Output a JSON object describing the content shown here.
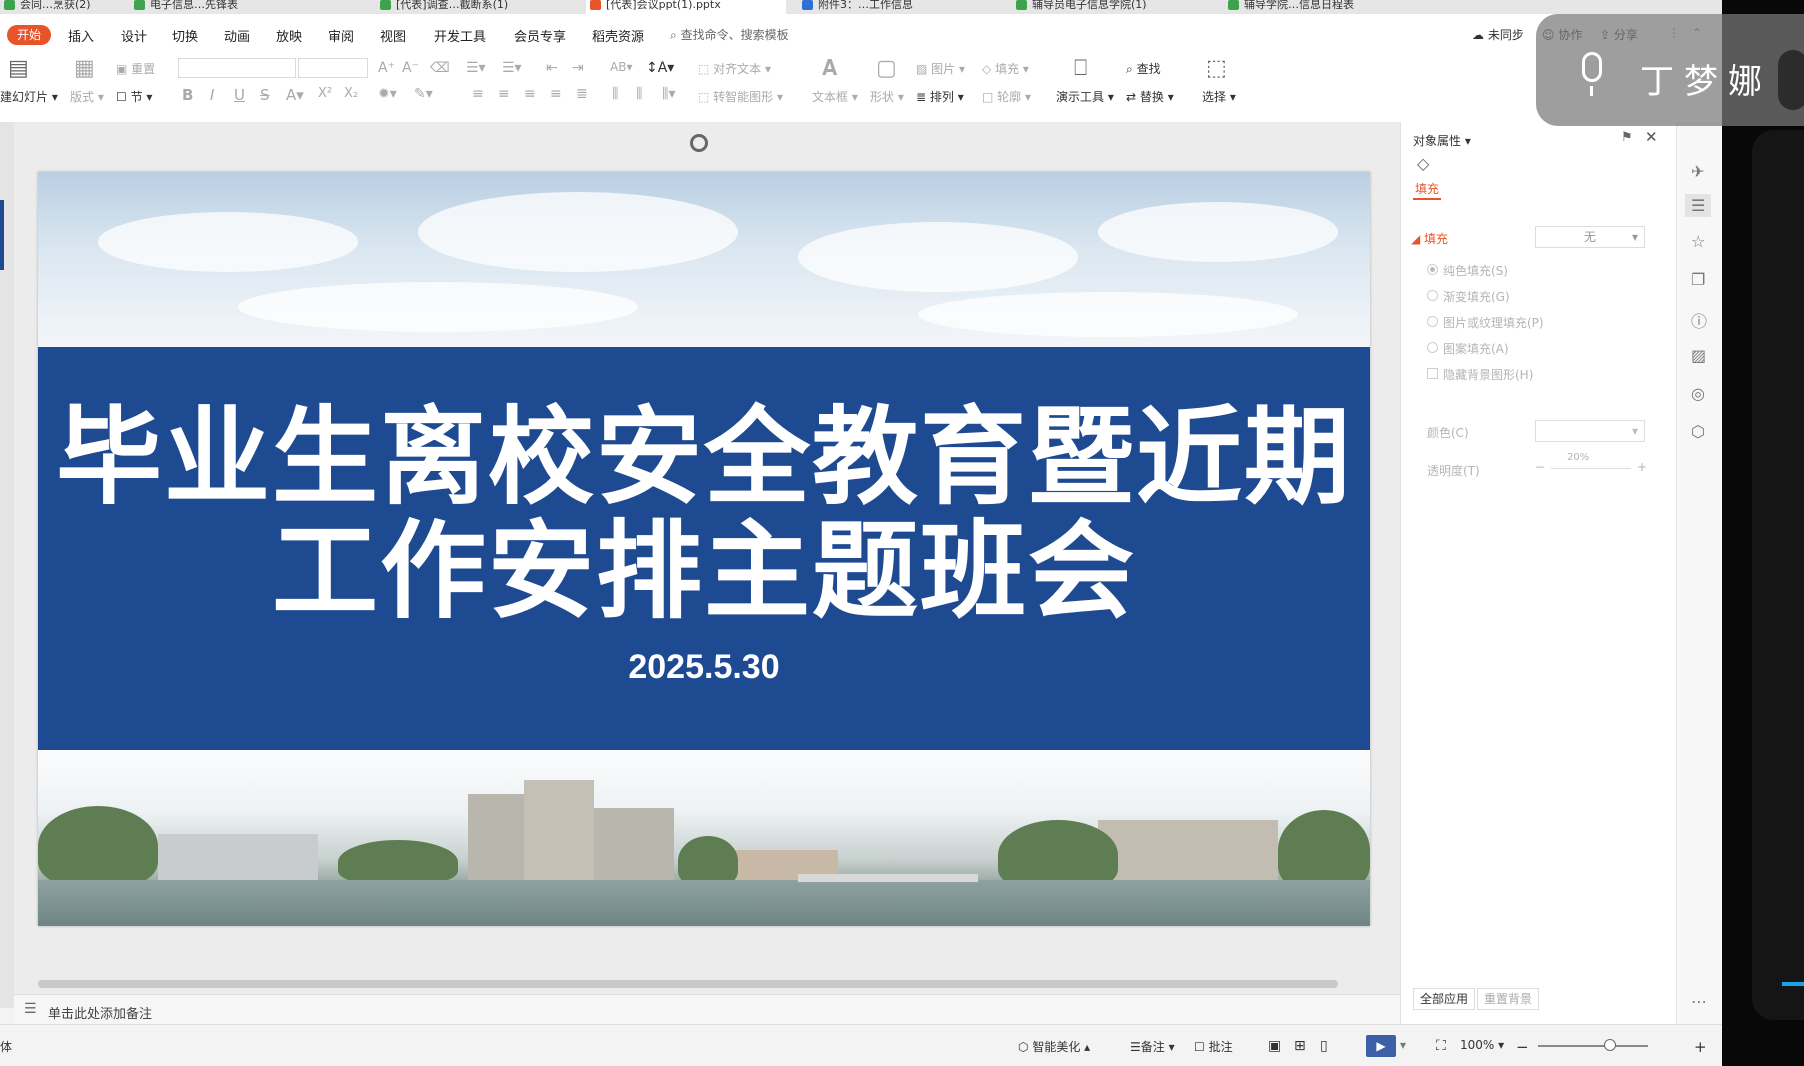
{
  "file_tabs": [
    {
      "label": "会同…烹获(2)",
      "color": "#3fa34d"
    },
    {
      "label": "电子信息…先锋表",
      "color": "#3fa34d"
    },
    {
      "label": "[代表]调查…截断系(1)",
      "color": "#3fa34d"
    },
    {
      "label": "[代表]会议ppt(1).pptx",
      "color": "#e8542a"
    },
    {
      "label": "附件3：…工作信息",
      "color": "#2f6fd6"
    },
    {
      "label": "辅导员电子信息学院(1)",
      "color": "#3fa34d"
    },
    {
      "label": "辅导学院…信息日程表",
      "color": "#3fa34d"
    }
  ],
  "menu": {
    "start": "开始",
    "items": [
      "插入",
      "设计",
      "切换",
      "动画",
      "放映",
      "审阅",
      "视图",
      "开发工具",
      "会员专享",
      "稻壳资源"
    ],
    "search": "查找命令、搜索模板",
    "right": {
      "sync": "未同步",
      "collab": "协作",
      "share": "分享"
    }
  },
  "ribbon": {
    "new_slide": "建幻灯片",
    "layout": "版式",
    "reset": "重置",
    "section": "节",
    "align_text": "对齐文本",
    "smart_shape": "转智能图形",
    "textbox": "文本框",
    "shape": "形状",
    "picture": "图片",
    "fill": "填充",
    "arrange": "排列",
    "outline": "轮廓",
    "present_tools": "演示工具",
    "find": "查找",
    "replace": "替换",
    "select": "选择"
  },
  "slide": {
    "title_line1": "毕业生离校安全教育暨近期",
    "title_line2": "工作安排主题班会",
    "date": "2025.5.30",
    "band_color": "#1e4a92"
  },
  "notes_placeholder": "单击此处添加备注",
  "pane": {
    "header": "对象属性",
    "tab": "填充",
    "section": "填充",
    "fill_value": "无",
    "options": [
      "纯色填充(S)",
      "渐变填充(G)",
      "图片或纹理填充(P)",
      "图案填充(A)"
    ],
    "hide_bg": "隐藏背景图形(H)",
    "color_label": "颜色(C)",
    "transparency_label": "透明度(T)",
    "transparency_value": "20%",
    "apply_all": "全部应用",
    "reset_bg": "重置背景",
    "accent": "#e8542a"
  },
  "status": {
    "font_hint": "体",
    "beautify": "智能美化",
    "notes": "备注",
    "comments": "批注",
    "zoom": "100%"
  },
  "voice": {
    "name": "丁梦娜"
  }
}
